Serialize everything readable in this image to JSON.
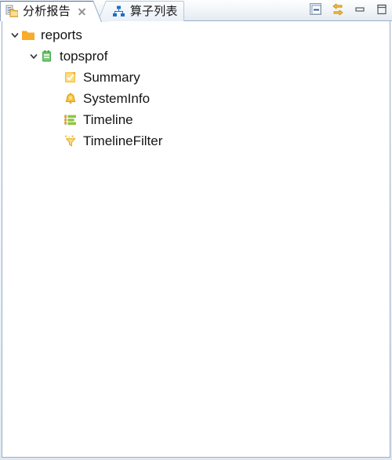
{
  "window": {
    "title": "分析报告",
    "background_color": "#ffffff",
    "frame_color": "#9aafc7"
  },
  "tabs": [
    {
      "label": "分析报告",
      "icon": "report-folder-icon",
      "active": true,
      "closable": true,
      "close_icon": "close-icon"
    },
    {
      "label": "算子列表",
      "icon": "hierarchy-icon",
      "active": false,
      "closable": false
    }
  ],
  "toolbar": {
    "buttons": [
      {
        "name": "collapse-all-button",
        "icon": "minimize-view-icon",
        "tooltip": "Collapse All"
      },
      {
        "name": "link-with-editor-button",
        "icon": "link-arrows-icon",
        "tooltip": "Link with Editor"
      },
      {
        "name": "minimize-button",
        "icon": "minimize-icon",
        "tooltip": "Minimize"
      },
      {
        "name": "maximize-button",
        "icon": "maximize-icon",
        "tooltip": "Maximize"
      }
    ]
  },
  "tree": {
    "nodes": [
      {
        "label": "reports",
        "icon": "folder-icon",
        "level": 0,
        "expanded": true,
        "has_twisty": true
      },
      {
        "label": "topsprof",
        "icon": "notepad-green-icon",
        "level": 1,
        "expanded": true,
        "has_twisty": true
      },
      {
        "label": "Summary",
        "icon": "note-check-icon",
        "level": 2,
        "expanded": false,
        "has_twisty": false
      },
      {
        "label": "SystemInfo",
        "icon": "bell-icon",
        "level": 2,
        "expanded": false,
        "has_twisty": false
      },
      {
        "label": "Timeline",
        "icon": "gantt-bars-icon",
        "level": 2,
        "expanded": false,
        "has_twisty": false
      },
      {
        "label": "TimelineFilter",
        "icon": "funnel-filter-icon",
        "level": 2,
        "expanded": false,
        "has_twisty": false
      }
    ]
  },
  "colors": {
    "folder_orange": "#f5a623",
    "notepad_green": "#5bb85b",
    "accent_yellow": "#f2c23e",
    "tab_border_blue": "#4a6d9a",
    "panel_border": "#9aafc7",
    "link_arrow_orange": "#d9971a",
    "hierarchy_blue": "#1f6fc4"
  }
}
